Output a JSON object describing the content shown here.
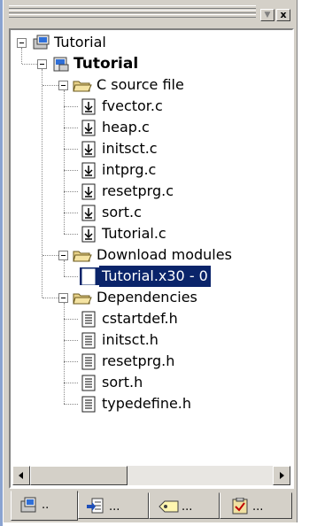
{
  "toolbar": {
    "dropdown_glyph": "▼",
    "close_glyph": "x"
  },
  "tree": {
    "root": {
      "label": "Tutorial",
      "icon": "workspace-icon",
      "expanded": true
    },
    "project": {
      "label": "Tutorial",
      "icon": "project-icon",
      "expanded": true
    },
    "folders": [
      {
        "label": "C source file",
        "icon": "open-folder-icon",
        "files": [
          "fvector.c",
          "heap.c",
          "initsct.c",
          "intprg.c",
          "resetprg.c",
          "sort.c",
          "Tutorial.c"
        ],
        "file_icon": "c-source-file-icon"
      },
      {
        "label": "Download modules",
        "icon": "open-folder-icon",
        "files": [
          "Tutorial.x30 - 0"
        ],
        "file_icon": "download-module-icon",
        "selected_index": 0
      },
      {
        "label": "Dependencies",
        "icon": "open-folder-icon",
        "files": [
          "cstartdef.h",
          "initsct.h",
          "resetprg.h",
          "sort.h",
          "typedefine.h"
        ],
        "file_icon": "header-file-icon"
      }
    ]
  },
  "scrollbar": {
    "left_arrow": "◀",
    "right_arrow": "▶"
  },
  "tabs": [
    {
      "label": "..",
      "icon": "workspace-icon",
      "active": true
    },
    {
      "label": "...",
      "icon": "navigation-icon",
      "active": false
    },
    {
      "label": "...",
      "icon": "label-tag-icon",
      "active": false
    },
    {
      "label": "...",
      "icon": "checklist-icon",
      "active": false
    }
  ],
  "colors": {
    "selection": "#0a246a",
    "panel": "#d4d0c8",
    "accent_strip": "#8aa3d0"
  }
}
